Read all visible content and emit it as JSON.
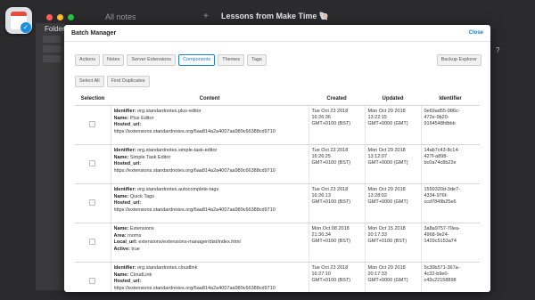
{
  "background": {
    "tab_all_notes": "All notes",
    "tab_plus": "+",
    "note_title": "Lessons from Make Time 🐚",
    "sidebar_label": "Folders",
    "help": "?"
  },
  "modal": {
    "title": "Batch Manager",
    "close_label": "Close",
    "tabs": [
      "Actions",
      "Notes",
      "Server Extensions",
      "Components",
      "Themes",
      "Tags"
    ],
    "active_tab": "Components",
    "backup_label": "Backup Explorer",
    "select_all_label": "Select All",
    "find_duplicates_label": "Find Duplicates",
    "columns": [
      "Selection",
      "Content",
      "Created",
      "Updated",
      "Identifier"
    ],
    "rows": [
      {
        "content": [
          {
            "k": "Identifier:",
            "v": " org.standardnotes.plus-editor"
          },
          {
            "k": "Name:",
            "v": " Plus Editor"
          },
          {
            "k": "Hosted_url:",
            "v": ""
          },
          {
            "k": "",
            "v": "https://extensions.standardnotes.org/6aa814a2a4007aa989c66388cd9710"
          }
        ],
        "created": "Tue Oct 23 2018\n16:26:36\nGMT+0100 (BST)",
        "updated": "Mon Oct 29 2018\n13:22:15\nGMT+0000 (GMT)",
        "identifier": "0e69ad55-086c-\n472e-9b20-\n9164548fdbbb"
      },
      {
        "content": [
          {
            "k": "Identifier:",
            "v": " org.standardnotes.simple-task-editor"
          },
          {
            "k": "Name:",
            "v": " Simple Task Editor"
          },
          {
            "k": "Hosted_url:",
            "v": ""
          },
          {
            "k": "",
            "v": "https://extensions.standardnotes.org/6aa814a2a4007aa989c66388cd9710"
          }
        ],
        "created": "Tue Oct 23 2018\n16:26:25\nGMT+0100 (BST)",
        "updated": "Mon Oct 29 2018\n13:12:07\nGMT+0000 (GMT)",
        "identifier": "14ab7c43-8c14-\n427f-a898-\nbc0a74c8b22e"
      },
      {
        "content": [
          {
            "k": "Identifier:",
            "v": " org.standardnotes.autocomplete-tags"
          },
          {
            "k": "Name:",
            "v": " Quick Tags"
          },
          {
            "k": "Hosted_url:",
            "v": ""
          },
          {
            "k": "",
            "v": "https://extensions.standardnotes.org/6aa814a2a4007aa989c66388cd9710"
          }
        ],
        "created": "Tue Oct 23 2018\n16:26:13\nGMT+0100 (BST)",
        "updated": "Mon Oct 29 2018\n13:28:02\nGMT+0000 (GMT)",
        "identifier": "1559320d-3de7-\n4334-976f-\nccd7849b25e6"
      },
      {
        "content": [
          {
            "k": "Name:",
            "v": " Extensions"
          },
          {
            "k": "Area:",
            "v": " rooms"
          },
          {
            "k": "Local_url:",
            "v": " extensions/extensions-manager/dist/index.html"
          },
          {
            "k": "Active:",
            "v": " true"
          }
        ],
        "created": "Mon Oct 08 2018\n21:36:34\nGMT+0100 (BST)",
        "updated": "Mon Oct 15 2018\n20:17:33\nGMT+0100 (BST)",
        "identifier": "3a8a9757-70ea-\n4968-9e24-\n1429c5153a74"
      },
      {
        "content": [
          {
            "k": "Identifier:",
            "v": " org.standardnotes.cloudlink"
          },
          {
            "k": "Name:",
            "v": " CloudLink"
          },
          {
            "k": "Hosted_url:",
            "v": ""
          },
          {
            "k": "",
            "v": "https://extensions.standardnotes.org/6aa814a2a4007aa989c66388cd9710"
          }
        ],
        "created": "Tue Oct 23 2018\n16:27:10\nGMT+0100 (BST)",
        "updated": "Mon Oct 29 2018\n20:17:33\nGMT+0000 (GMT)",
        "identifier": "5c30b571-367a-\n4c32-b9e0-\nc43c22158898"
      }
    ]
  }
}
